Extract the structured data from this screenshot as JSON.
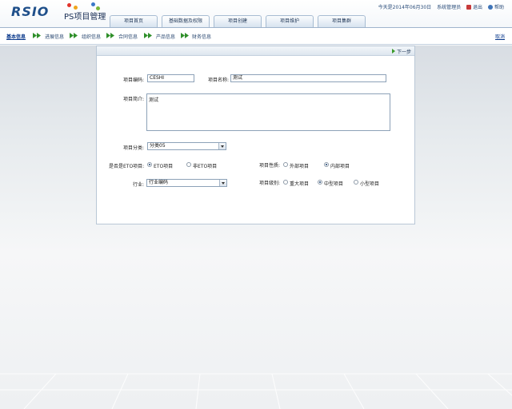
{
  "header": {
    "logo_text": "RSIO",
    "app_title": "PS项目管理",
    "date_text": "今天是2014年06月30日",
    "user_text": "系统管理员",
    "logout_label": "退出",
    "help_label": "帮助"
  },
  "tabs": [
    {
      "label": "项目首页"
    },
    {
      "label": "基础数据及权限"
    },
    {
      "label": "项目创建"
    },
    {
      "label": "项目维护"
    },
    {
      "label": "项目集群"
    }
  ],
  "breadcrumb": {
    "steps": [
      {
        "label": "基本信息"
      },
      {
        "label": "进展信息"
      },
      {
        "label": "组织信息"
      },
      {
        "label": "合同信息"
      },
      {
        "label": "产品信息"
      },
      {
        "label": "财务信息"
      }
    ],
    "cancel_label": "取消"
  },
  "panel": {
    "next_label": "下一步"
  },
  "form": {
    "project_code": {
      "label": "项目编码:",
      "value": "CESHI"
    },
    "project_name": {
      "label": "项目名称:",
      "value": "测试"
    },
    "project_desc": {
      "label": "项目简介:",
      "value": "测试"
    },
    "project_category": {
      "label": "项目分类:",
      "value": "分类05"
    },
    "is_eto": {
      "label": "是否是ETO项目:",
      "options": [
        "ETO项目",
        "非ETO项目"
      ],
      "selected": 0
    },
    "project_nature": {
      "label": "项目性质:",
      "options": [
        "外部项目",
        "内部项目"
      ],
      "selected": 1
    },
    "industry": {
      "label": "行业:",
      "value": "行业编码"
    },
    "project_level": {
      "label": "项目级别:",
      "options": [
        "重大项目",
        "中型项目",
        "小型项目"
      ],
      "selected": 1
    }
  },
  "colors": {
    "brand_blue": "#1f4f8a",
    "arrow_green": "#3a9a2a",
    "link_blue": "#0b3a8c"
  }
}
